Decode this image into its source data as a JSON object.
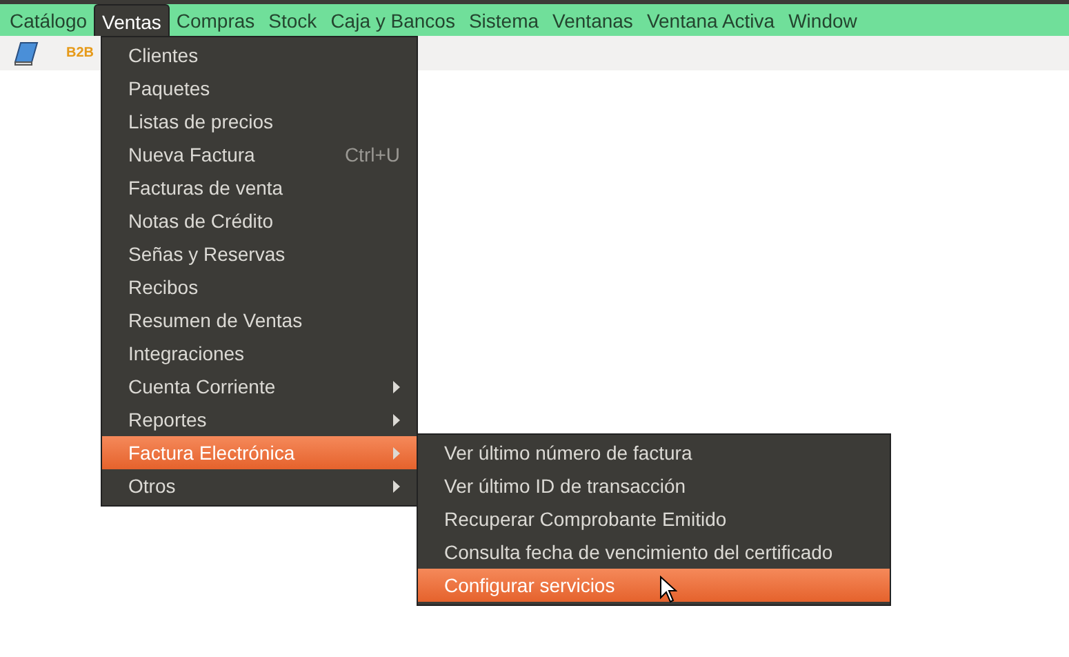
{
  "menubar": [
    {
      "label": "Catálogo",
      "selected": false
    },
    {
      "label": "Ventas",
      "selected": true
    },
    {
      "label": "Compras",
      "selected": false
    },
    {
      "label": "Stock",
      "selected": false
    },
    {
      "label": "Caja y Bancos",
      "selected": false
    },
    {
      "label": "Sistema",
      "selected": false
    },
    {
      "label": "Ventanas",
      "selected": false
    },
    {
      "label": "Ventana Activa",
      "selected": false
    },
    {
      "label": "Window",
      "selected": false
    }
  ],
  "toolbar": {
    "logo": "B2B"
  },
  "menu": [
    {
      "label": "Clientes",
      "selected": false,
      "submenu": false
    },
    {
      "label": "Paquetes",
      "selected": false,
      "submenu": false
    },
    {
      "label": "Listas de precios",
      "selected": false,
      "submenu": false
    },
    {
      "label": "Nueva Factura",
      "shortcut": "Ctrl+U",
      "selected": false,
      "submenu": false
    },
    {
      "label": "Facturas de venta",
      "selected": false,
      "submenu": false
    },
    {
      "label": "Notas de Crédito",
      "selected": false,
      "submenu": false
    },
    {
      "label": "Señas y Reservas",
      "selected": false,
      "submenu": false
    },
    {
      "label": "Recibos",
      "selected": false,
      "submenu": false
    },
    {
      "label": "Resumen de Ventas",
      "selected": false,
      "submenu": false
    },
    {
      "label": "Integraciones",
      "selected": false,
      "submenu": false
    },
    {
      "label": "Cuenta Corriente",
      "selected": false,
      "submenu": true
    },
    {
      "label": "Reportes",
      "selected": false,
      "submenu": true
    },
    {
      "label": "Factura Electrónica",
      "selected": true,
      "submenu": true
    },
    {
      "label": "Otros",
      "selected": false,
      "submenu": true
    }
  ],
  "submenu": [
    {
      "label": "Ver último número de factura",
      "selected": false
    },
    {
      "label": "Ver último ID de transacción",
      "selected": false
    },
    {
      "label": "Recuperar Comprobante Emitido",
      "selected": false
    },
    {
      "label": "Consulta fecha de vencimiento del certificado",
      "selected": false
    },
    {
      "label": "Configurar servicios",
      "selected": true
    }
  ]
}
